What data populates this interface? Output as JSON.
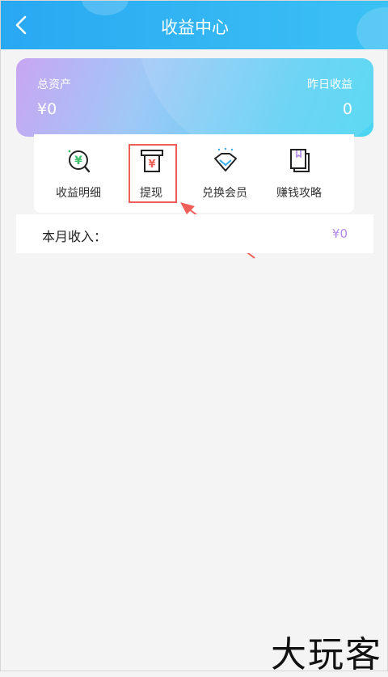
{
  "header": {
    "title": "收益中心"
  },
  "asset_card": {
    "total_label": "总资产",
    "total_value": "¥0",
    "yesterday_label": "昨日收益",
    "yesterday_value": "0"
  },
  "quick_actions": [
    {
      "label": "收益明细",
      "icon": "yen-magnifier-icon"
    },
    {
      "label": "提现",
      "icon": "atm-withdraw-icon"
    },
    {
      "label": "兑换会员",
      "icon": "diamond-icon"
    },
    {
      "label": "赚钱攻略",
      "icon": "book-icon"
    }
  ],
  "income": {
    "label": "本月收入：",
    "value": "¥0"
  },
  "watermark": "大玩客",
  "colors": {
    "header": "#29a8f2",
    "highlight": "#ef5f5a",
    "income_value": "#b388e8",
    "green_icon": "#3fbf6a",
    "red_icon": "#ef5f5a"
  }
}
